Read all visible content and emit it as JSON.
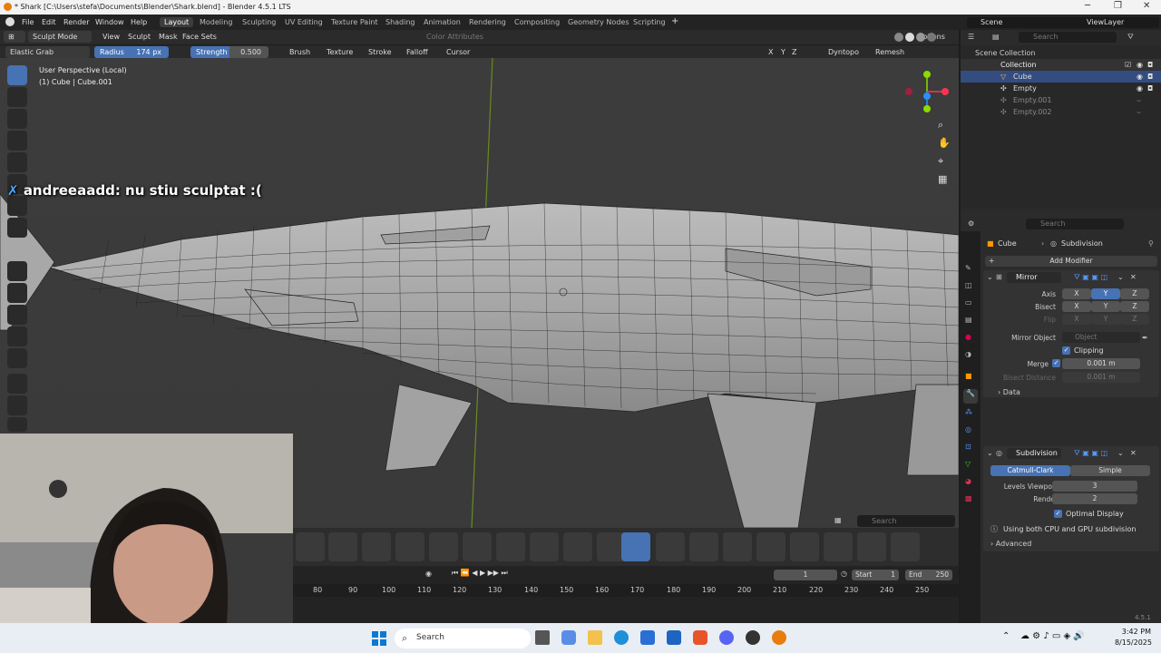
{
  "title_bar": {
    "title": "* Shark [C:\\Users\\stefa\\Documents\\Blender\\Shark.blend] - Blender 4.5.1 LTS"
  },
  "menu": [
    "File",
    "Edit",
    "Render",
    "Window",
    "Help"
  ],
  "workspaces": [
    "Layout",
    "Modeling",
    "Sculpting",
    "UV Editing",
    "Texture Paint",
    "Shading",
    "Animation",
    "Rendering",
    "Compositing",
    "Geometry Nodes",
    "Scripting"
  ],
  "active_workspace": "Layout",
  "scene": {
    "scene_label": "Scene",
    "view_layer_label": "ViewLayer"
  },
  "viewport_header": {
    "mode": "Sculpt Mode",
    "menus": [
      "View",
      "Sculpt",
      "Mask",
      "Face Sets"
    ],
    "color_attributes": "Color Attributes",
    "options": "Options"
  },
  "tool_header": {
    "brush_name": "Elastic Grab",
    "radius_label": "Radius",
    "radius_value": "174 px",
    "strength_label": "Strength",
    "strength_value": "0.500",
    "menus": [
      "Brush",
      "Texture",
      "Stroke",
      "Falloff",
      "Cursor"
    ],
    "axes": [
      "X",
      "Y",
      "Z"
    ],
    "dyntopo": "Dyntopo",
    "remesh": "Remesh"
  },
  "viewport": {
    "perspective": "User Perspective (Local)",
    "object": "(1) Cube | Cube.001",
    "chat_user": "andreeaadd:",
    "chat_msg": "nu stiu sculptat :(",
    "search_placeholder": "Search"
  },
  "outliner": {
    "search_placeholder": "Search",
    "items": [
      {
        "label": "Scene Collection"
      },
      {
        "label": "Collection"
      },
      {
        "label": "Cube"
      },
      {
        "label": "Empty"
      },
      {
        "label": "Empty.001"
      },
      {
        "label": "Empty.002"
      }
    ]
  },
  "properties": {
    "search_placeholder": "Search",
    "breadcrumb_object": "Cube",
    "breadcrumb_modifier": "Subdivision",
    "add_modifier": "Add Modifier",
    "mirror": {
      "name": "Mirror",
      "axis_label": "Axis",
      "bisect_label": "Bisect",
      "flip_label": "Flip",
      "axes": [
        "X",
        "Y",
        "Z"
      ],
      "mirror_object_label": "Mirror Object",
      "mirror_object_placeholder": "Object",
      "clipping_label": "Clipping",
      "merge_label": "Merge",
      "merge_value": "0.001 m",
      "bisect_distance_label": "Bisect Distance",
      "bisect_distance_value": "0.001 m",
      "data_label": "Data"
    },
    "subdivision": {
      "name": "Subdivision",
      "catmull": "Catmull-Clark",
      "simple": "Simple",
      "levels_viewport_label": "Levels Viewport",
      "levels_viewport_value": "3",
      "render_label": "Render",
      "render_value": "2",
      "optimal_display_label": "Optimal Display",
      "info": "Using both CPU and GPU subdivision",
      "advanced_label": "Advanced"
    }
  },
  "timeline": {
    "current_frame": "1",
    "start_label": "Start",
    "start_value": "1",
    "end_label": "End",
    "end_value": "250",
    "ticks": [
      "80",
      "90",
      "100",
      "110",
      "120",
      "130",
      "140",
      "150",
      "160",
      "170",
      "180",
      "190",
      "200",
      "210",
      "220",
      "230",
      "240",
      "250"
    ],
    "version": "4.5.1"
  },
  "taskbar": {
    "search_label": "Search",
    "time": "3:42 PM",
    "date": "8/15/2025"
  },
  "colors": {
    "accent": "#4772b3",
    "panel": "#2b2b2b",
    "viewport_bg": "#3d3d3d"
  }
}
